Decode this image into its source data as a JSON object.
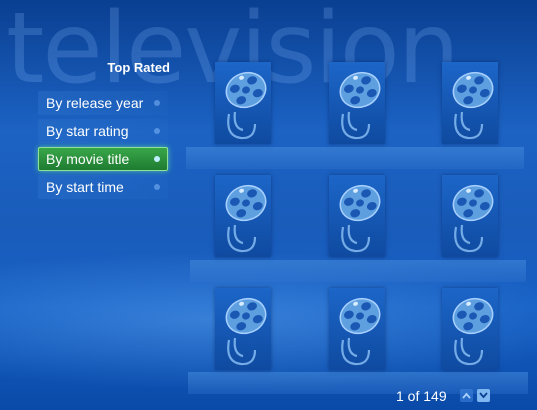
{
  "background_word": "television",
  "section_title": "Top Rated",
  "menu": {
    "items": [
      {
        "label": "By release year",
        "selected": false
      },
      {
        "label": "By star rating",
        "selected": false
      },
      {
        "label": "By movie title",
        "selected": true
      },
      {
        "label": "By start time",
        "selected": false
      }
    ]
  },
  "grid": {
    "tile_icon": "film-reel-icon",
    "tile_count": 9
  },
  "pager": {
    "text": "1 of 149",
    "up_icon": "chevron-up-icon",
    "down_icon": "chevron-down-icon"
  },
  "colors": {
    "background": "#1c63c4",
    "selection": "#2f9440",
    "text": "#ffffff"
  }
}
